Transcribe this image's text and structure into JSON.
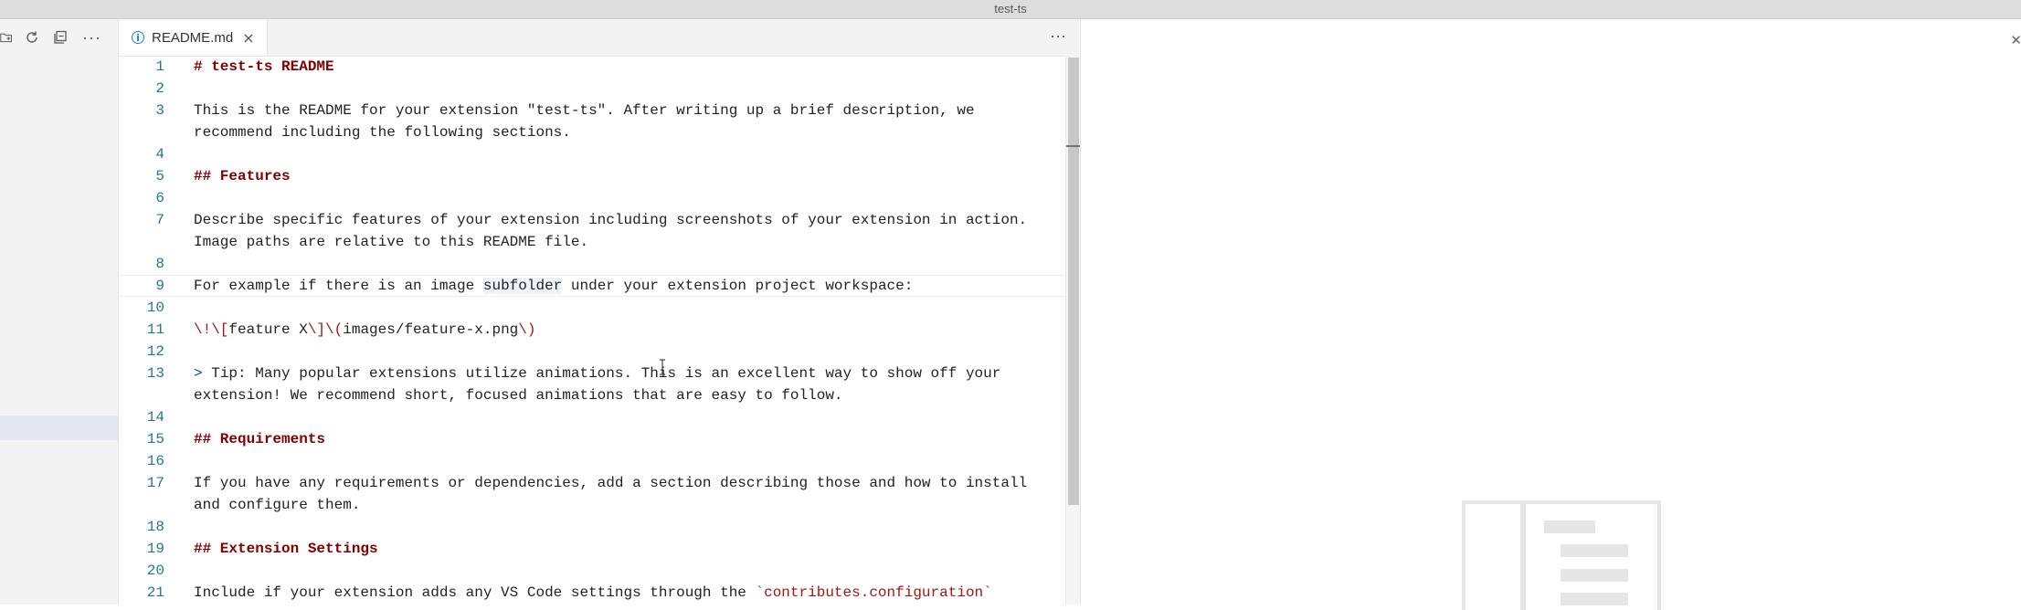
{
  "window": {
    "title": "test-ts"
  },
  "tabs": [
    {
      "label": "README.md",
      "close_glyph": "×",
      "icon": "info-icon"
    }
  ],
  "more_glyph": "···",
  "sidebar": {
    "icons": [
      "new-folder-icon",
      "refresh-icon",
      "collapse-all-icon",
      "more-icon"
    ]
  },
  "lines": [
    {
      "n": "1",
      "parts": [
        {
          "t": "# test-ts README",
          "c": "h"
        }
      ]
    },
    {
      "n": "2",
      "parts": []
    },
    {
      "n": "3",
      "parts": [
        {
          "t": "This is the README for your extension \"test-ts\". After writing up a brief description, we",
          "c": ""
        }
      ]
    },
    {
      "n": "",
      "parts": [
        {
          "t": "recommend including the following sections.",
          "c": ""
        }
      ]
    },
    {
      "n": "4",
      "parts": []
    },
    {
      "n": "5",
      "parts": [
        {
          "t": "## Features",
          "c": "h"
        }
      ]
    },
    {
      "n": "6",
      "parts": []
    },
    {
      "n": "7",
      "parts": [
        {
          "t": "Describe specific features of your extension including screenshots of your extension in action.",
          "c": ""
        }
      ]
    },
    {
      "n": "",
      "parts": [
        {
          "t": "Image paths are relative to this README file.",
          "c": ""
        }
      ]
    },
    {
      "n": "8",
      "parts": []
    },
    {
      "n": "9",
      "parts": [
        {
          "t": "For example if there is an image ",
          "c": ""
        },
        {
          "t": "subfolder",
          "c": "wordhl"
        },
        {
          "t": " under your extension project workspace:",
          "c": ""
        }
      ]
    },
    {
      "n": "10",
      "parts": []
    },
    {
      "n": "11",
      "parts": [
        {
          "t": "\\!\\[",
          "c": "esc"
        },
        {
          "t": "feature X",
          "c": ""
        },
        {
          "t": "\\]\\(",
          "c": "esc"
        },
        {
          "t": "images/feature-x.png",
          "c": ""
        },
        {
          "t": "\\)",
          "c": "esc"
        }
      ]
    },
    {
      "n": "12",
      "parts": []
    },
    {
      "n": "13",
      "parts": [
        {
          "t": ">",
          "c": "quote"
        },
        {
          "t": " Tip: Many popular extensions utilize animations. This is an excellent way to show off your",
          "c": ""
        }
      ]
    },
    {
      "n": "",
      "parts": [
        {
          "t": "extension! We recommend short, focused animations that are easy to follow.",
          "c": ""
        }
      ]
    },
    {
      "n": "14",
      "parts": []
    },
    {
      "n": "15",
      "parts": [
        {
          "t": "## Requirements",
          "c": "h"
        }
      ]
    },
    {
      "n": "16",
      "parts": []
    },
    {
      "n": "17",
      "parts": [
        {
          "t": "If you have any requirements or dependencies, add a section describing those and how to install",
          "c": ""
        }
      ]
    },
    {
      "n": "",
      "parts": [
        {
          "t": "and configure them.",
          "c": ""
        }
      ]
    },
    {
      "n": "18",
      "parts": []
    },
    {
      "n": "19",
      "parts": [
        {
          "t": "## Extension Settings",
          "c": "h"
        }
      ]
    },
    {
      "n": "20",
      "parts": []
    },
    {
      "n": "21",
      "parts": [
        {
          "t": "Include if your extension adds any VS Code settings through the ",
          "c": ""
        },
        {
          "t": "`contributes.configuration`",
          "c": "codespan"
        }
      ]
    }
  ],
  "current_line": "9",
  "preview": {
    "placeholder_icon": "document-icon"
  }
}
